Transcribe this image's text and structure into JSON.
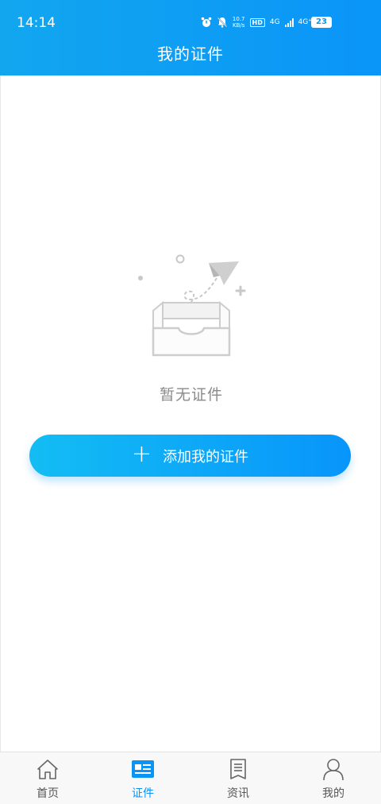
{
  "status_bar": {
    "time": "14:14",
    "speed_value": "10.7",
    "speed_unit": "KB/s",
    "hd_label": "HD",
    "network_1": "4G",
    "network_2": "4G⁺",
    "battery": "23"
  },
  "header": {
    "title": "我的证件"
  },
  "empty_state": {
    "text": "暂无证件"
  },
  "add_button": {
    "icon": "plus-icon",
    "label": "添加我的证件"
  },
  "tabbar": {
    "active_index": 1,
    "items": [
      {
        "icon": "home-icon",
        "label": "首页"
      },
      {
        "icon": "id-card-icon",
        "label": "证件"
      },
      {
        "icon": "news-icon",
        "label": "资讯"
      },
      {
        "icon": "user-icon",
        "label": "我的"
      }
    ]
  },
  "colors": {
    "primary": "#0a95f5",
    "header_start": "#12a6ef",
    "header_end": "#0a95f8",
    "muted_text": "#8a8a8a"
  }
}
